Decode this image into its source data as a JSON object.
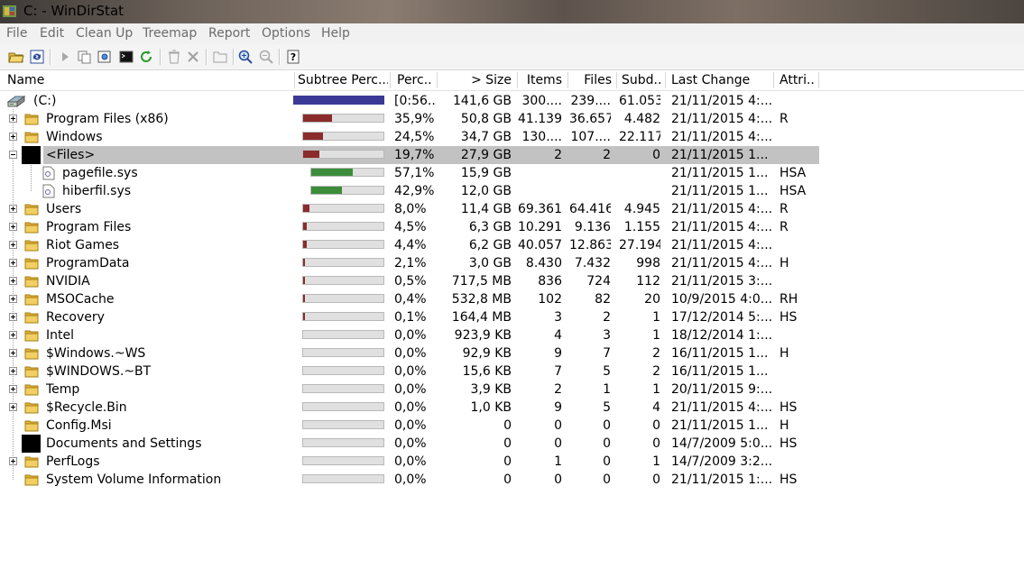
{
  "window": {
    "title": "C: - WinDirStat"
  },
  "menu": [
    "File",
    "Edit",
    "Clean Up",
    "Treemap",
    "Report",
    "Options",
    "Help"
  ],
  "toolbar": [
    "open-icon",
    "refresh-icon",
    "play-icon",
    "copy-icon",
    "explorer-icon",
    "command-prompt-icon",
    "refresh-selected-icon",
    "recycle-icon",
    "delete-icon",
    "new-folder-icon",
    "zoom-in-icon",
    "zoom-out-icon",
    "help-icon"
  ],
  "columns": [
    "Name",
    "Subtree Perc...",
    "Perc...",
    "> Size",
    "Items",
    "Files",
    "Subd...",
    "Last Change",
    "Attri..."
  ],
  "colors": {
    "drive_bar": "#3a3a96",
    "folder_bar": "#8b2b2b",
    "file_bar": "#3c8c3c",
    "selection": "#c2c2c2"
  },
  "rows": [
    {
      "name": "(C:)",
      "percent": "[0:56...",
      "size": "141,6 GB",
      "items": "300....",
      "files": "239....",
      "subdirs": "61.053",
      "last_change": "21/11/2015  4:...",
      "attributes": "",
      "subtree_fraction": 1.0
    },
    {
      "name": "Program Files (x86)",
      "percent": "35,9%",
      "size": "50,8 GB",
      "items": "41.139",
      "files": "36.657",
      "subdirs": "4.482",
      "last_change": "21/11/2015  4:...",
      "attributes": "R",
      "subtree_fraction": 0.359
    },
    {
      "name": "Windows",
      "percent": "24,5%",
      "size": "34,7 GB",
      "items": "130....",
      "files": "107....",
      "subdirs": "22.117",
      "last_change": "21/11/2015  4:...",
      "attributes": "",
      "subtree_fraction": 0.245
    },
    {
      "name": "<Files>",
      "percent": "19,7%",
      "size": "27,9 GB",
      "items": "2",
      "files": "2",
      "subdirs": "0",
      "last_change": "21/11/2015  1...",
      "attributes": "",
      "subtree_fraction": 0.197
    },
    {
      "name": "pagefile.sys",
      "percent": "57,1%",
      "size": "15,9 GB",
      "items": "",
      "files": "",
      "subdirs": "",
      "last_change": "21/11/2015  1...",
      "attributes": "HSA",
      "subtree_fraction": 0.571
    },
    {
      "name": "hiberfil.sys",
      "percent": "42,9%",
      "size": "12,0 GB",
      "items": "",
      "files": "",
      "subdirs": "",
      "last_change": "21/11/2015  1...",
      "attributes": "HSA",
      "subtree_fraction": 0.429
    },
    {
      "name": "Users",
      "percent": "8,0%",
      "size": "11,4 GB",
      "items": "69.361",
      "files": "64.416",
      "subdirs": "4.945",
      "last_change": "21/11/2015  4:...",
      "attributes": "R",
      "subtree_fraction": 0.08
    },
    {
      "name": "Program Files",
      "percent": "4,5%",
      "size": "6,3 GB",
      "items": "10.291",
      "files": "9.136",
      "subdirs": "1.155",
      "last_change": "21/11/2015  4:...",
      "attributes": "R",
      "subtree_fraction": 0.045
    },
    {
      "name": "Riot Games",
      "percent": "4,4%",
      "size": "6,2 GB",
      "items": "40.057",
      "files": "12.863",
      "subdirs": "27.194",
      "last_change": "21/11/2015  4:...",
      "attributes": "",
      "subtree_fraction": 0.044
    },
    {
      "name": "ProgramData",
      "percent": "2,1%",
      "size": "3,0 GB",
      "items": "8.430",
      "files": "7.432",
      "subdirs": "998",
      "last_change": "21/11/2015  4:...",
      "attributes": "H",
      "subtree_fraction": 0.021
    },
    {
      "name": "NVIDIA",
      "percent": "0,5%",
      "size": "717,5 MB",
      "items": "836",
      "files": "724",
      "subdirs": "112",
      "last_change": "21/11/2015  3:...",
      "attributes": "",
      "subtree_fraction": 0.005
    },
    {
      "name": "MSOCache",
      "percent": "0,4%",
      "size": "532,8 MB",
      "items": "102",
      "files": "82",
      "subdirs": "20",
      "last_change": "10/9/2015  4:0...",
      "attributes": "RH",
      "subtree_fraction": 0.004
    },
    {
      "name": "Recovery",
      "percent": "0,1%",
      "size": "164,4 MB",
      "items": "3",
      "files": "2",
      "subdirs": "1",
      "last_change": "17/12/2014  5:...",
      "attributes": "HS",
      "subtree_fraction": 0.001
    },
    {
      "name": "Intel",
      "percent": "0,0%",
      "size": "923,9 KB",
      "items": "4",
      "files": "3",
      "subdirs": "1",
      "last_change": "18/12/2014  1:...",
      "attributes": "",
      "subtree_fraction": 0.0
    },
    {
      "name": "$Windows.~WS",
      "percent": "0,0%",
      "size": "92,9 KB",
      "items": "9",
      "files": "7",
      "subdirs": "2",
      "last_change": "16/11/2015  1...",
      "attributes": "H",
      "subtree_fraction": 0.0
    },
    {
      "name": "$WINDOWS.~BT",
      "percent": "0,0%",
      "size": "15,6 KB",
      "items": "7",
      "files": "5",
      "subdirs": "2",
      "last_change": "16/11/2015  1...",
      "attributes": "",
      "subtree_fraction": 0.0
    },
    {
      "name": "Temp",
      "percent": "0,0%",
      "size": "3,9 KB",
      "items": "2",
      "files": "1",
      "subdirs": "1",
      "last_change": "20/11/2015  9:...",
      "attributes": "",
      "subtree_fraction": 0.0
    },
    {
      "name": "$Recycle.Bin",
      "percent": "0,0%",
      "size": "1,0 KB",
      "items": "9",
      "files": "5",
      "subdirs": "4",
      "last_change": "21/11/2015  4:...",
      "attributes": "HS",
      "subtree_fraction": 0.0
    },
    {
      "name": "Config.Msi",
      "percent": "0,0%",
      "size": "0",
      "items": "0",
      "files": "0",
      "subdirs": "0",
      "last_change": "21/11/2015  1...",
      "attributes": "H",
      "subtree_fraction": 0.0
    },
    {
      "name": "Documents and Settings",
      "percent": "0,0%",
      "size": "0",
      "items": "0",
      "files": "0",
      "subdirs": "0",
      "last_change": "14/7/2009  5:0...",
      "attributes": "HS",
      "subtree_fraction": 0.0
    },
    {
      "name": "PerfLogs",
      "percent": "0,0%",
      "size": "0",
      "items": "1",
      "files": "0",
      "subdirs": "1",
      "last_change": "14/7/2009  3:2...",
      "attributes": "",
      "subtree_fraction": 0.0
    },
    {
      "name": "System Volume Information",
      "percent": "0,0%",
      "size": "0",
      "items": "0",
      "files": "0",
      "subdirs": "0",
      "last_change": "21/11/2015  1:...",
      "attributes": "HS",
      "subtree_fraction": 0.0
    }
  ]
}
